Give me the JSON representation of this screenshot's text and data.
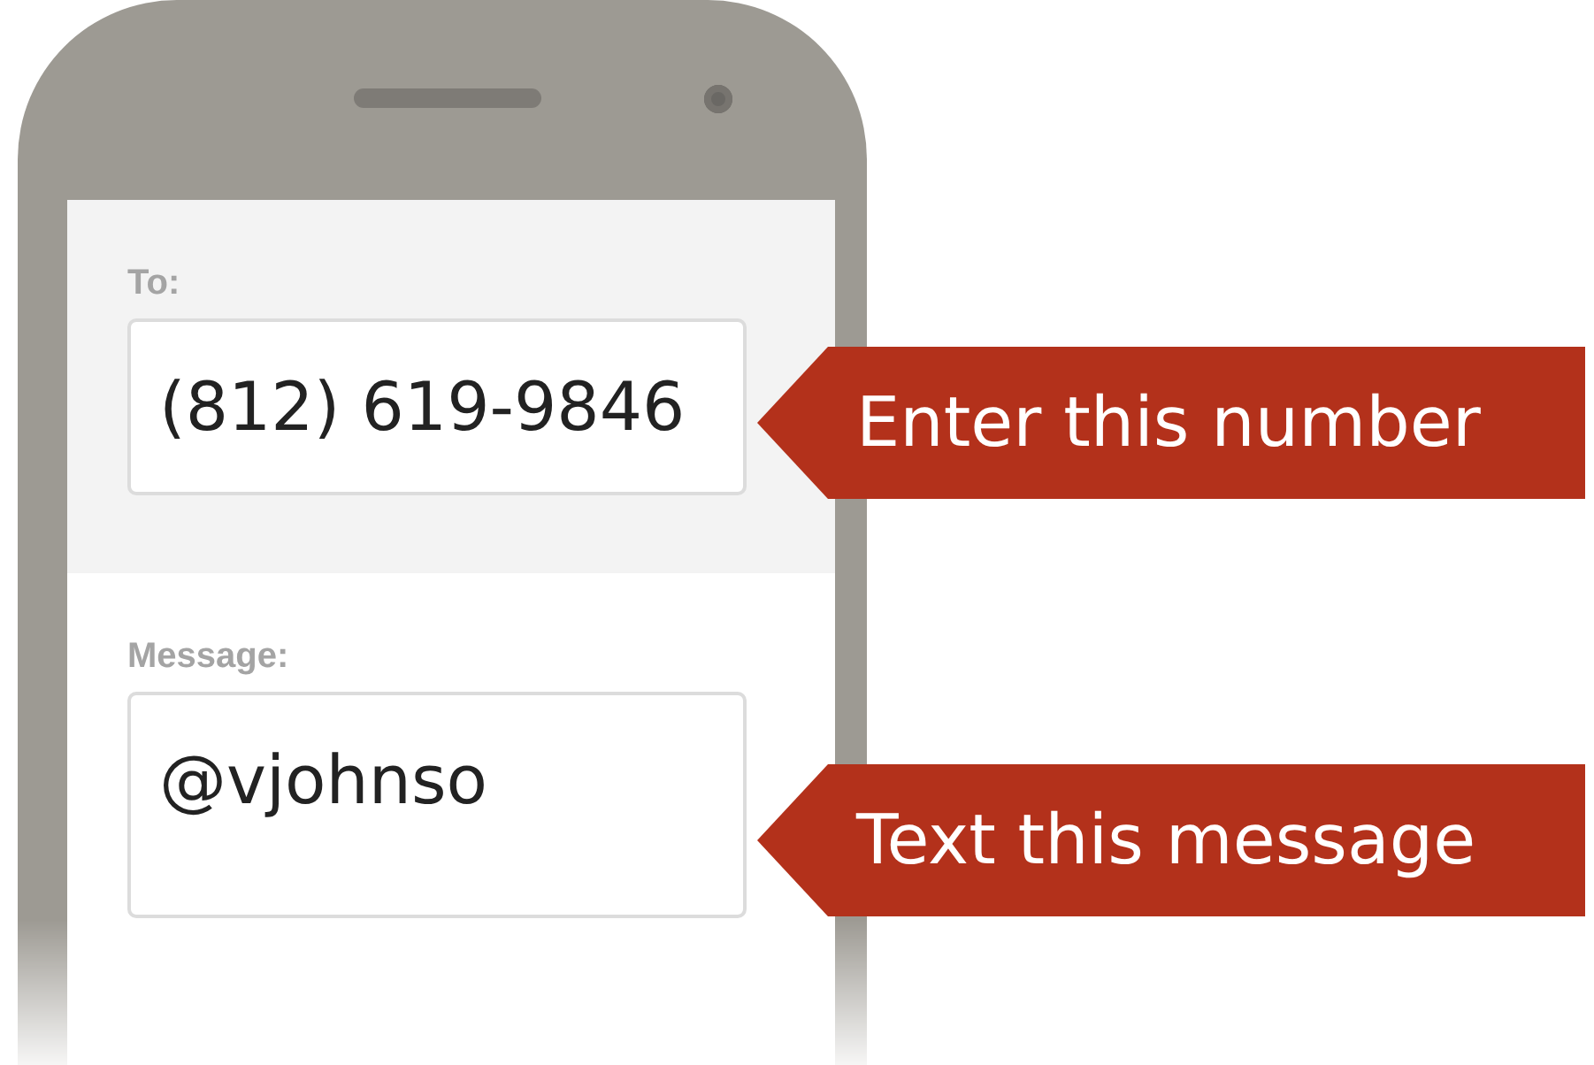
{
  "to_field": {
    "label": "To:",
    "value": "(812) 619-9846"
  },
  "message_field": {
    "label": "Message:",
    "value": "@vjohnso"
  },
  "callouts": [
    {
      "text": "Enter this number"
    },
    {
      "text": "Text this message"
    }
  ]
}
